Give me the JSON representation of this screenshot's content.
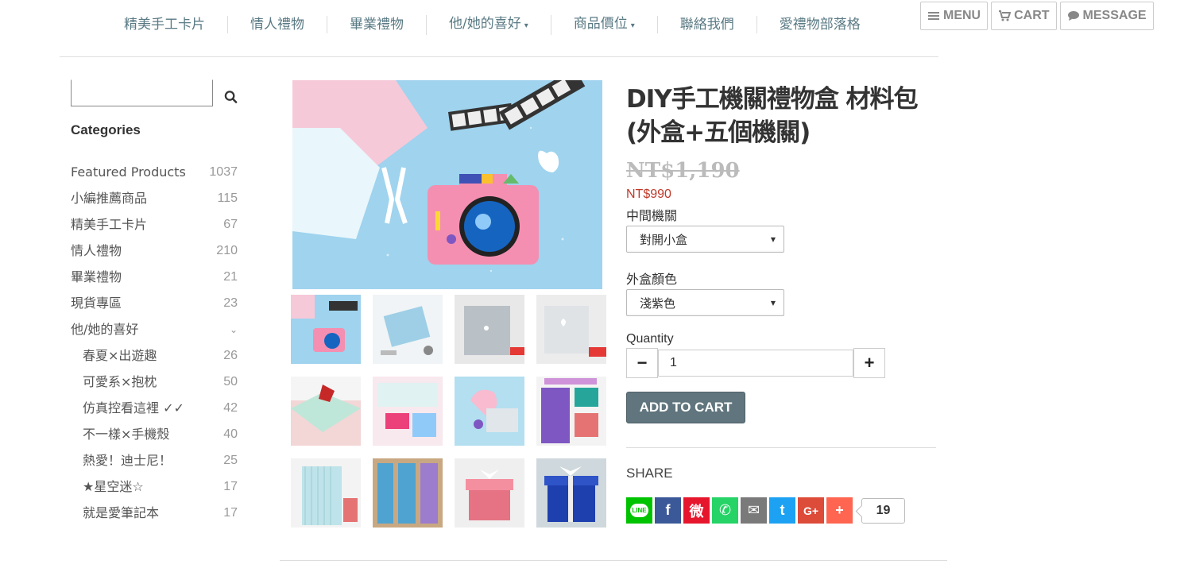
{
  "nav": {
    "items": [
      {
        "label": "精美手工卡片",
        "has_caret": false
      },
      {
        "label": "情人禮物",
        "has_caret": false
      },
      {
        "label": "畢業禮物",
        "has_caret": false
      },
      {
        "label": "他/她的喜好",
        "has_caret": true
      },
      {
        "label": "商品價位",
        "has_caret": true
      },
      {
        "label": "聯絡我們",
        "has_caret": false
      },
      {
        "label": "愛禮物部落格",
        "has_caret": false
      }
    ],
    "caret": "▾",
    "menu_label": "MENU",
    "cart_label": "CART",
    "message_label": "MESSAGE"
  },
  "sidebar": {
    "search_placeholder": "",
    "categories_title": "Categories",
    "categories": [
      {
        "name": "Featured Products",
        "count": "1037",
        "sub": false
      },
      {
        "name": "小編推薦商品",
        "count": "115",
        "sub": false
      },
      {
        "name": "精美手工卡片",
        "count": "67",
        "sub": false
      },
      {
        "name": "情人禮物",
        "count": "210",
        "sub": false
      },
      {
        "name": "畢業禮物",
        "count": "21",
        "sub": false
      },
      {
        "name": "現貨專區",
        "count": "23",
        "sub": false
      },
      {
        "name": "他/她的喜好",
        "count": "⌄",
        "sub": false
      },
      {
        "name": "春夏×出遊趣",
        "count": "26",
        "sub": true
      },
      {
        "name": "可愛系×抱枕",
        "count": "50",
        "sub": true
      },
      {
        "name": "仿真控看這裡 ✓✓",
        "count": "42",
        "sub": true
      },
      {
        "name": "不一樣×手機殼",
        "count": "40",
        "sub": true
      },
      {
        "name": "熱愛！迪士尼！",
        "count": "25",
        "sub": true
      },
      {
        "name": "★星空迷☆",
        "count": "17",
        "sub": true
      },
      {
        "name": "就是愛筆記本",
        "count": "17",
        "sub": true
      }
    ]
  },
  "product": {
    "title": "DIY手工機關禮物盒 材料包(外盒+五個機關)",
    "old_price": "NT$1,190",
    "price": "NT$990",
    "option1_label": "中間機關",
    "option1_value": "對開小盒",
    "option2_label": "外盒顏色",
    "option2_value": "淺紫色",
    "quantity_label": "Quantity",
    "quantity_value": "1",
    "minus": "−",
    "plus": "+",
    "add_to_cart": "ADD TO CART",
    "share_label": "SHARE",
    "share_count": "19"
  },
  "share_buttons": [
    {
      "name": "line-share-button",
      "color": "#00c300",
      "glyph": "LINE"
    },
    {
      "name": "facebook-share-button",
      "color": "#3b5998",
      "glyph": "f"
    },
    {
      "name": "weibo-share-button",
      "color": "#e6162d",
      "glyph": "微"
    },
    {
      "name": "whatsapp-share-button",
      "color": "#25d366",
      "glyph": "✆"
    },
    {
      "name": "email-share-button",
      "color": "#7a7a7a",
      "glyph": "✉"
    },
    {
      "name": "twitter-share-button",
      "color": "#1da1f2",
      "glyph": "t"
    },
    {
      "name": "googleplus-share-button",
      "color": "#dd4b39",
      "glyph": "G+"
    },
    {
      "name": "more-share-button",
      "color": "#ff6550",
      "glyph": "+"
    }
  ]
}
